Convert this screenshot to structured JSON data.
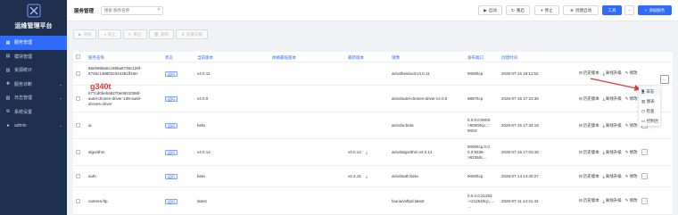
{
  "app": {
    "title": "运维管理平台",
    "logo_icon": "x-logo-icon"
  },
  "sidebar": {
    "items": [
      {
        "label": "服务管理",
        "icon": "grid-icon",
        "active": true,
        "chevron": false
      },
      {
        "label": "模块管理",
        "icon": "module-icon",
        "active": false,
        "chevron": false
      },
      {
        "label": "资源统计",
        "icon": "chart-icon",
        "active": false,
        "chevron": false
      },
      {
        "label": "服务诊断",
        "icon": "stethoscope-icon",
        "active": false,
        "chevron": true
      },
      {
        "label": "日志管理",
        "icon": "log-icon",
        "active": false,
        "chevron": true
      },
      {
        "label": "系统设置",
        "icon": "gear-icon",
        "active": false,
        "chevron": false
      },
      {
        "label": "admin",
        "icon": "user-icon",
        "active": false,
        "chevron": true
      }
    ]
  },
  "header": {
    "title": "服务管理",
    "search_placeholder": "搜索 服务名称",
    "buttons": {
      "start": "启动",
      "restart": "重启",
      "stop": "停止",
      "create_start": "创建启动",
      "tools": "工具",
      "more": "···",
      "add": "添加服务"
    }
  },
  "toolbar": {
    "start": "开始",
    "stop": "停止",
    "restart": "重启",
    "delete": "删除",
    "offline_upgrade": "批量升级"
  },
  "table": {
    "columns": [
      "服务名称",
      "状态",
      "当前版本",
      "依赖最低版本",
      "最新版本",
      "镜像",
      "发布端口",
      "创建时间"
    ],
    "rows": [
      {
        "name_lines": [
          "66eb968a5cc885a6739c128f-",
          "6746c1489032344351ff160-",
          "g340t"
        ],
        "status": "运行",
        "version": "v4.0.11",
        "min_version": "",
        "latest": "",
        "image": "airiot/beidou3:v4.0.11",
        "ports": [
          "9000/tcp"
        ],
        "created": "2025-07-15 18:11:52"
      },
      {
        "name_lines": [
          "677cd0beba5270e0921f386f-",
          "autel-drones-driver-139-autel-",
          "drones-driver"
        ],
        "status": "运行",
        "version": "v4.0.0",
        "min_version": "",
        "latest": "",
        "image": "airiot/autel-drones-driver:v4.0.0",
        "ports": [
          "9887/tcp"
        ],
        "created": "2025-07-16 17:23:36"
      },
      {
        "name_lines": [
          "ai"
        ],
        "status": "运行",
        "version": "beta",
        "min_version": "",
        "latest": "",
        "image": "airiot/ai:beta",
        "ports": [
          "0.0.0.0:9003-",
          ">9000/tcp,:::",
          "9003-"
        ],
        "created": "2025-07-15 17:34:18"
      },
      {
        "name_lines": [
          "algorithm"
        ],
        "status": "运行",
        "version": "v4.0.14",
        "min_version": "",
        "latest": "v4.0.14",
        "image": "airiot/algorithm:v4.0.14",
        "ports": [
          "9000/tcp,0.0.",
          "0.0:9236-",
          ">9236/tc..."
        ],
        "created": "2025-07-16 17:03:46"
      },
      {
        "name_lines": [
          "auth"
        ],
        "status": "运行",
        "version": "beta",
        "min_version": "",
        "latest": "v4.4.15",
        "image": "airiot/auth:beta",
        "ports": [
          "9000/tcp"
        ],
        "created": "2025-07-14 14:40:27"
      },
      {
        "name_lines": [
          "camera-ftp"
        ],
        "status": "运行",
        "version": "latest",
        "min_version": "",
        "latest": "",
        "image": "fauria/vsftpd:latest",
        "ports": [
          "0.0.0.0:21253",
          "->21253/tcp,:...",
          "..."
        ],
        "created": "2025-07-11 14:41:43"
      }
    ],
    "actions": {
      "history": "历史版本",
      "offline_upgrade": "离线升级",
      "edit": "修改"
    }
  },
  "overlay_text": "g340t",
  "dropdown": {
    "items": [
      "日志",
      "图表",
      "检查",
      "控制台"
    ]
  },
  "colors": {
    "sidebar_bg": "#1f2f4e",
    "accent": "#2f6bff",
    "annotation_red": "#e53935"
  }
}
